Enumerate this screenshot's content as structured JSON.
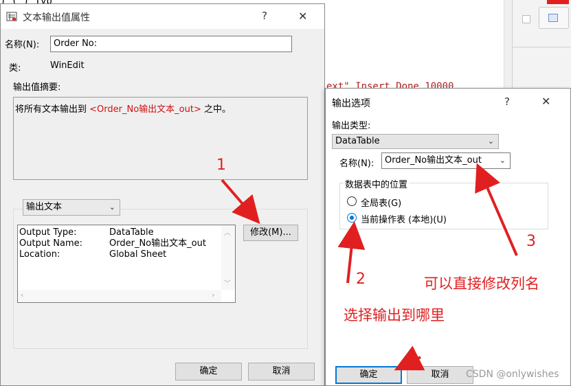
{
  "background": {
    "code_top": ") (        ) Typ",
    "code_mid": "ext\"   Insert Done   10000"
  },
  "dialog1": {
    "title": "文本输出值属性",
    "help_glyph": "?",
    "close_glyph": "✕",
    "name_label": "名称(N):",
    "name_value": "Order No:",
    "class_label": "类:",
    "class_value": "WinEdit",
    "summary_label": "输出值摘要:",
    "summary_prefix": "将所有文本输出到 ",
    "summary_link": "<Order_No输出文本_out>",
    "summary_suffix": " 之中。",
    "output_type_combo": "输出文本",
    "details": [
      {
        "key": "Output Type:",
        "value": "DataTable"
      },
      {
        "key": "Output Name:",
        "value": "Order_No输出文本_out"
      },
      {
        "key": "Location:",
        "value": "Global Sheet"
      }
    ],
    "modify_button": "修改(M)...",
    "ok_button": "确定",
    "cancel_button": "取消"
  },
  "dialog2": {
    "title": "输出选项",
    "help_glyph": "?",
    "close_glyph": "✕",
    "output_type_label": "输出类型:",
    "output_type_value": "DataTable",
    "name_label": "名称(N):",
    "name_value": "Order_No输出文本_out",
    "position_group_label": "数据表中的位置",
    "radio_global": "全局表(G)",
    "radio_current": "当前操作表 (本地)(U)",
    "selected": "current",
    "ok_button": "确定",
    "cancel_button": "取消"
  },
  "annotations": {
    "num1": "1",
    "num2": "2",
    "num3": "3",
    "text_rename": "可以直接修改列名",
    "text_choose": "选择输出到哪里"
  },
  "watermark": "CSDN @onlywishes",
  "colors": {
    "annotation_red": "#e02020",
    "focus_blue": "#0078d7"
  }
}
